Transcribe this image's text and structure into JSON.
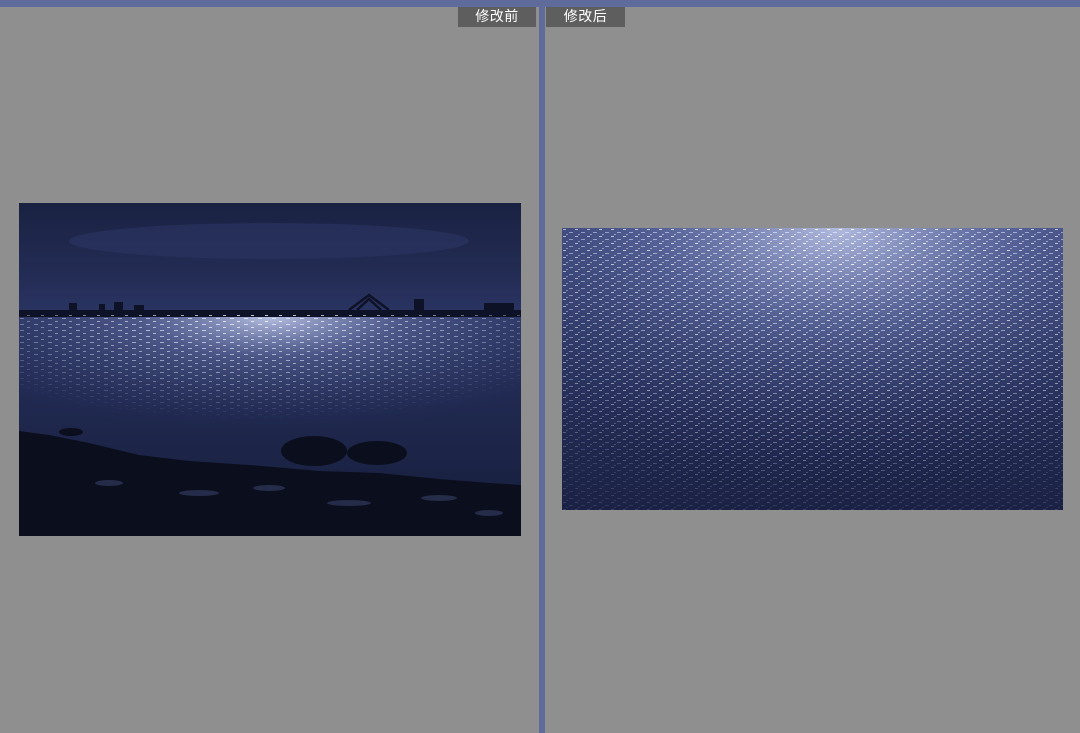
{
  "comparison": {
    "before": {
      "label": "修改前",
      "image": "night-lake-moonlight-with-rocks"
    },
    "after": {
      "label": "修改后",
      "image": "sparkling-water-closeup"
    }
  },
  "colors": {
    "frame": "#5f6b9b",
    "panel_bg": "#8f8f8f",
    "tab_bg": "#5e5e5e",
    "tab_text": "#ffffff"
  }
}
